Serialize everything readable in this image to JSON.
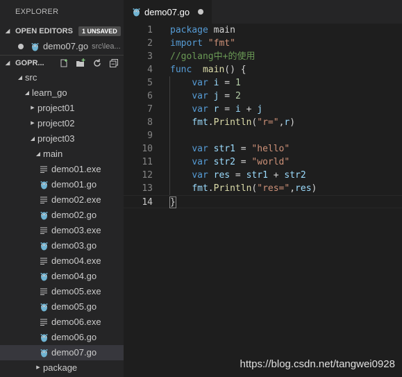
{
  "sidebar": {
    "title": "EXPLORER",
    "open_editors": {
      "label": "OPEN EDITORS",
      "badge": "1 UNSAVED",
      "items": [
        {
          "name": "demo07.go",
          "path": "src\\lea..."
        }
      ]
    },
    "workspace": {
      "label": "GOPR..."
    },
    "tree": [
      {
        "label": "src",
        "kind": "folder-open",
        "depth": 1
      },
      {
        "label": "learn_go",
        "kind": "folder-open",
        "depth": 2
      },
      {
        "label": "project01",
        "kind": "folder-closed",
        "depth": 3
      },
      {
        "label": "project02",
        "kind": "folder-closed",
        "depth": 3
      },
      {
        "label": "project03",
        "kind": "folder-open",
        "depth": 3
      },
      {
        "label": "main",
        "kind": "folder-open",
        "depth": 4
      },
      {
        "label": "demo01.exe",
        "kind": "exe",
        "depth": 5
      },
      {
        "label": "demo01.go",
        "kind": "go",
        "depth": 5
      },
      {
        "label": "demo02.exe",
        "kind": "exe",
        "depth": 5
      },
      {
        "label": "demo02.go",
        "kind": "go",
        "depth": 5
      },
      {
        "label": "demo03.exe",
        "kind": "exe",
        "depth": 5
      },
      {
        "label": "demo03.go",
        "kind": "go",
        "depth": 5
      },
      {
        "label": "demo04.exe",
        "kind": "exe",
        "depth": 5
      },
      {
        "label": "demo04.go",
        "kind": "go",
        "depth": 5
      },
      {
        "label": "demo05.exe",
        "kind": "exe",
        "depth": 5
      },
      {
        "label": "demo05.go",
        "kind": "go",
        "depth": 5
      },
      {
        "label": "demo06.exe",
        "kind": "exe",
        "depth": 5
      },
      {
        "label": "demo06.go",
        "kind": "go",
        "depth": 5
      },
      {
        "label": "demo07.go",
        "kind": "go",
        "depth": 5,
        "selected": true
      },
      {
        "label": "package",
        "kind": "folder-closed",
        "depth": 4
      }
    ],
    "toolbar_icons": [
      "new-file-icon",
      "new-folder-icon",
      "refresh-icon",
      "collapse-all-icon"
    ]
  },
  "editor": {
    "tab": {
      "label": "demo07.go",
      "unsaved": true
    },
    "current_line": 14,
    "lines": [
      {
        "n": "1",
        "tokens": [
          [
            "kw",
            "package"
          ],
          [
            "",
            "main"
          ]
        ]
      },
      {
        "n": "2",
        "tokens": [
          [
            "kw",
            "import"
          ],
          [
            "str",
            "\"fmt\""
          ]
        ]
      },
      {
        "n": "3",
        "tokens": [
          [
            "cm",
            "//golang中+的使用"
          ]
        ]
      },
      {
        "n": "4",
        "tokens": [
          [
            "kw",
            "func"
          ],
          [
            "fn",
            " main"
          ],
          [
            "",
            "() {"
          ]
        ]
      },
      {
        "n": "5",
        "tokens": [
          [
            "",
            "    "
          ],
          [
            "kw",
            "var"
          ],
          [
            "var",
            " i"
          ],
          [
            "",
            " = "
          ],
          [
            "num",
            "1"
          ]
        ]
      },
      {
        "n": "6",
        "tokens": [
          [
            "",
            "    "
          ],
          [
            "kw",
            "var"
          ],
          [
            "var",
            " j"
          ],
          [
            "",
            " = "
          ],
          [
            "num",
            "2"
          ]
        ]
      },
      {
        "n": "7",
        "tokens": [
          [
            "",
            "    "
          ],
          [
            "kw",
            "var"
          ],
          [
            "var",
            " r"
          ],
          [
            "",
            " = "
          ],
          [
            "var",
            "i"
          ],
          [
            "",
            " + "
          ],
          [
            "var",
            "j"
          ]
        ]
      },
      {
        "n": "8",
        "tokens": [
          [
            "",
            "    "
          ],
          [
            "var",
            "fmt"
          ],
          [
            "",
            "."
          ],
          [
            "fn",
            "Println"
          ],
          [
            "",
            "("
          ],
          [
            "str",
            "\"r=\""
          ],
          [
            "",
            ","
          ],
          [
            "var",
            "r"
          ],
          [
            "",
            ")"
          ]
        ]
      },
      {
        "n": "9",
        "tokens": []
      },
      {
        "n": "10",
        "tokens": [
          [
            "",
            "    "
          ],
          [
            "kw",
            "var"
          ],
          [
            "var",
            " str1"
          ],
          [
            "",
            " = "
          ],
          [
            "str",
            "\"hello\""
          ]
        ]
      },
      {
        "n": "11",
        "tokens": [
          [
            "",
            "    "
          ],
          [
            "kw",
            "var"
          ],
          [
            "var",
            " str2"
          ],
          [
            "",
            " = "
          ],
          [
            "str",
            "\"world\""
          ]
        ]
      },
      {
        "n": "12",
        "tokens": [
          [
            "",
            "    "
          ],
          [
            "kw",
            "var"
          ],
          [
            "var",
            " res"
          ],
          [
            "",
            " = "
          ],
          [
            "var",
            "str1"
          ],
          [
            "",
            " + "
          ],
          [
            "var",
            "str2"
          ]
        ]
      },
      {
        "n": "13",
        "tokens": [
          [
            "",
            "    "
          ],
          [
            "var",
            "fmt"
          ],
          [
            "",
            "."
          ],
          [
            "fn",
            "Println"
          ],
          [
            "",
            "("
          ],
          [
            "str",
            "\"res=\""
          ],
          [
            "",
            ","
          ],
          [
            "var",
            "res"
          ],
          [
            "",
            ")"
          ]
        ]
      },
      {
        "n": "14",
        "tokens": [
          [
            "brace",
            "}"
          ]
        ]
      }
    ]
  },
  "watermark": "https://blog.csdn.net/tangwei0928"
}
